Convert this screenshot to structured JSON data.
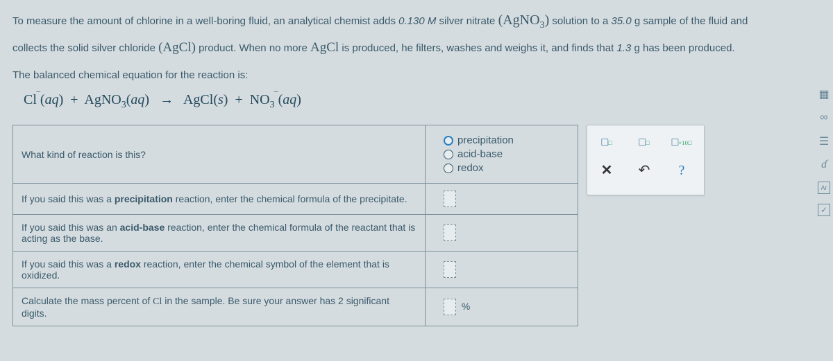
{
  "problem": {
    "line1_a": "To measure the amount of chlorine in a well-boring fluid, an analytical chemist adds ",
    "molarity": "0.130",
    "molarity_unit": "M",
    "line1_b": " silver nitrate ",
    "agno3": "(AgNO",
    "line1_c": " solution to a ",
    "sample_mass": "35.0",
    "mass_unit": "g",
    "line1_d": " sample of the fluid and",
    "line2_a": "collects the solid silver chloride ",
    "agcl_formula": "(AgCl)",
    "line2_b": " product. When no more ",
    "agcl_plain": "AgCl",
    "line2_c": " is produced, he filters, washes and weighs it, and finds that ",
    "product_mass": "1.3",
    "line2_d": " has been produced.",
    "line3": "The balanced chemical equation for the reaction is:"
  },
  "equation": {
    "cl": "Cl",
    "cl_charge": "−",
    "aq1": "(aq)",
    "plus": " + ",
    "agno3": "AgNO",
    "sub3": "3",
    "arrow": "→",
    "agcl": "AgCl",
    "s": "(s)",
    "no3": "NO",
    "no3_charge": "−"
  },
  "rows": {
    "r1": "What kind of reaction is this?",
    "options": {
      "precipitation": "precipitation",
      "acid_base": "acid-base",
      "redox": "redox"
    },
    "r2": "If you said this was a precipitation reaction, enter the chemical formula of the precipitate.",
    "r3": "If you said this was an acid-base reaction, enter the chemical formula of the reactant that is acting as the base.",
    "r4": "If you said this was a redox reaction, enter the chemical symbol of the element that is oxidized.",
    "r5": "Calculate the mass percent of Cl in the sample. Be sure your answer has 2 significant digits.",
    "percent_unit": "%"
  },
  "palette": {
    "superscript": "□",
    "subscript": "□",
    "sci": "×10",
    "close": "✕",
    "undo": "↶",
    "help": "?"
  },
  "side_icons": {
    "i1": "page-icon",
    "i2": "infinity-icon",
    "i3": "list-icon",
    "i4": "data-icon",
    "i5": "periodic-icon",
    "i6": "check-icon"
  }
}
